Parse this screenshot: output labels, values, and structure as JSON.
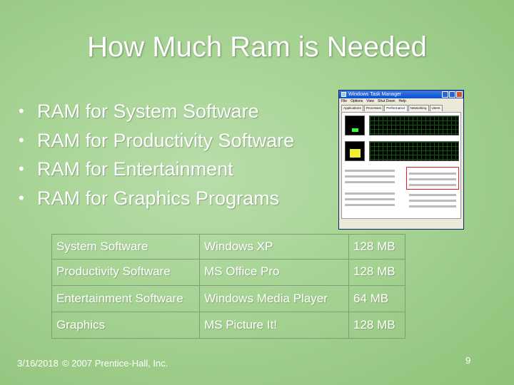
{
  "title": "How Much Ram is Needed",
  "bullets": [
    "RAM for System Software",
    "RAM for Productivity Software",
    "RAM for Entertainment",
    "RAM for Graphics Programs"
  ],
  "bullet_symbol": "•",
  "task_manager": {
    "window_title": "Windows Task Manager",
    "menu": [
      "File",
      "Options",
      "View",
      "Shut Down",
      "Help"
    ],
    "tabs": [
      "Applications",
      "Processes",
      "Performance",
      "Networking",
      "Users"
    ],
    "active_tab": "Performance"
  },
  "table": {
    "rows": [
      [
        "System Software",
        "Windows XP",
        "128 MB"
      ],
      [
        "Productivity Software",
        "MS Office Pro",
        "128 MB"
      ],
      [
        "Entertainment Software",
        "Windows Media Player",
        "64 MB"
      ],
      [
        "Graphics",
        "MS Picture It!",
        "128 MB"
      ]
    ]
  },
  "footer": {
    "date": "3/16/2018",
    "copyright": "© 2007 Prentice-Hall, Inc."
  },
  "page_number": "9"
}
